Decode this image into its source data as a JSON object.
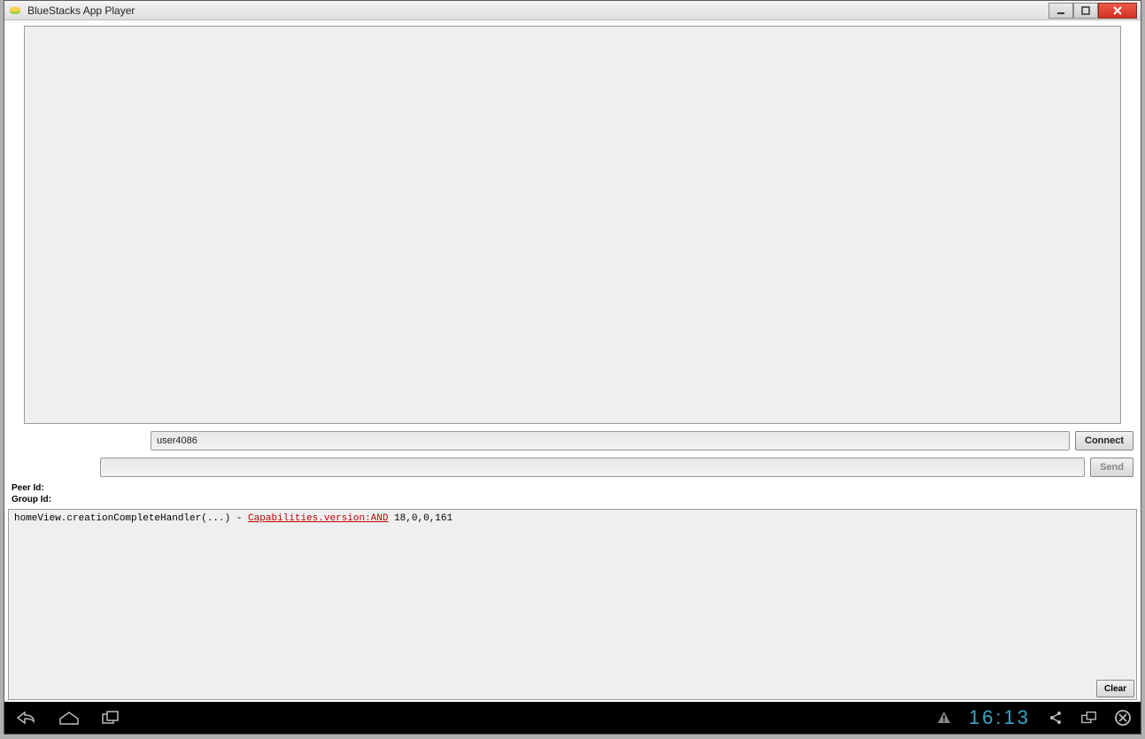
{
  "window": {
    "title": "BlueStacks App Player"
  },
  "inputs": {
    "username": "user4086",
    "message": ""
  },
  "buttons": {
    "connect": "Connect",
    "send": "Send",
    "clear": "Clear"
  },
  "labels": {
    "peer_id": "Peer Id:",
    "group_id": "Group Id:"
  },
  "log": {
    "prefix": "homeView.creationCompleteHandler(...) - ",
    "highlight": "Capabilities.version:AND",
    "suffix": " 18,0,0,161"
  },
  "statusbar": {
    "time": "16:13"
  }
}
